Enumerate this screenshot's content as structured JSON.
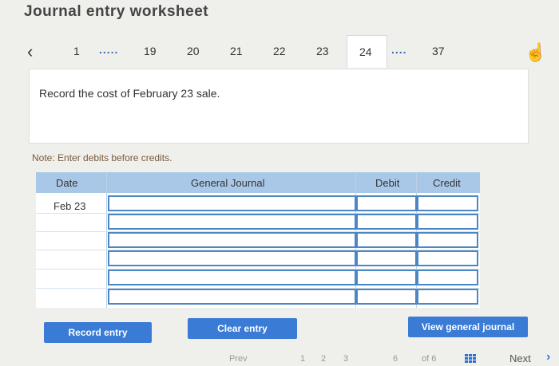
{
  "header": {
    "title": "Journal entry worksheet"
  },
  "pager": {
    "prev_icon": "chevron-left-icon",
    "pages": [
      "1",
      "19",
      "20",
      "21",
      "22",
      "23",
      "24",
      "37"
    ],
    "dots": ".....",
    "dots2": "....",
    "active": "24"
  },
  "question": {
    "text": "Record the cost of February 23 sale."
  },
  "note": "Note: Enter debits before credits.",
  "table": {
    "headers": {
      "date": "Date",
      "journal": "General Journal",
      "debit": "Debit",
      "credit": "Credit"
    },
    "rows": [
      {
        "date": "Feb 23",
        "account": "",
        "debit": "",
        "credit": ""
      },
      {
        "date": "",
        "account": "",
        "debit": "",
        "credit": ""
      },
      {
        "date": "",
        "account": "",
        "debit": "",
        "credit": ""
      },
      {
        "date": "",
        "account": "",
        "debit": "",
        "credit": ""
      },
      {
        "date": "",
        "account": "",
        "debit": "",
        "credit": ""
      },
      {
        "date": "",
        "account": "",
        "debit": "",
        "credit": ""
      }
    ]
  },
  "buttons": {
    "record": "Record entry",
    "clear": "Clear entry",
    "view": "View general journal"
  },
  "footer": {
    "prev": "Prev",
    "pages_a": "1",
    "pages_b": "2",
    "pages_c": "3",
    "page_of": "6",
    "of_text": "of 6",
    "next": "Next"
  },
  "colors": {
    "accent": "#3a7bd5",
    "table_header": "#a9c8e8"
  }
}
